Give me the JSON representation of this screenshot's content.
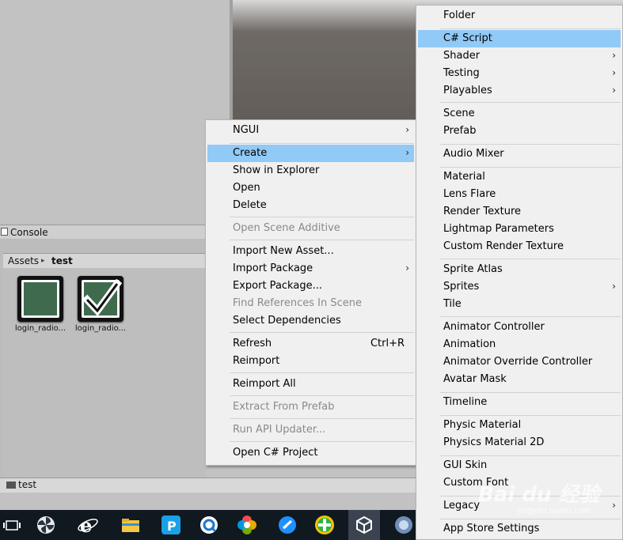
{
  "console": {
    "tab_label": "Console"
  },
  "breadcrumb": {
    "root": "Assets",
    "separator": "▸",
    "current": "test"
  },
  "assets": [
    {
      "name": "login_radio...",
      "icon": "empty-radio-icon"
    },
    {
      "name": "login_radio...",
      "icon": "checked-radio-icon"
    }
  ],
  "bottom_path": "test",
  "left_menu": {
    "items": [
      {
        "label": "NGUI",
        "submenu": true
      },
      {
        "label": "Create",
        "submenu": true,
        "highlighted": true
      },
      {
        "label": "Show in Explorer"
      },
      {
        "label": "Open"
      },
      {
        "label": "Delete"
      },
      {
        "label": "Open Scene Additive",
        "disabled": true
      },
      {
        "label": "Import New Asset..."
      },
      {
        "label": "Import Package",
        "submenu": true
      },
      {
        "label": "Export Package..."
      },
      {
        "label": "Find References In Scene",
        "disabled": true
      },
      {
        "label": "Select Dependencies"
      },
      {
        "label": "Refresh",
        "shortcut": "Ctrl+R"
      },
      {
        "label": "Reimport"
      },
      {
        "label": "Reimport All"
      },
      {
        "label": "Extract From Prefab",
        "disabled": true
      },
      {
        "label": "Run API Updater...",
        "disabled": true
      },
      {
        "label": "Open C# Project"
      }
    ]
  },
  "right_menu": {
    "items": [
      {
        "label": "Folder"
      },
      {
        "label": "C# Script",
        "highlighted": true
      },
      {
        "label": "Shader",
        "submenu": true
      },
      {
        "label": "Testing",
        "submenu": true
      },
      {
        "label": "Playables",
        "submenu": true
      },
      {
        "label": "Scene"
      },
      {
        "label": "Prefab"
      },
      {
        "label": "Audio Mixer"
      },
      {
        "label": "Material"
      },
      {
        "label": "Lens Flare"
      },
      {
        "label": "Render Texture"
      },
      {
        "label": "Lightmap Parameters"
      },
      {
        "label": "Custom Render Texture"
      },
      {
        "label": "Sprite Atlas"
      },
      {
        "label": "Sprites",
        "submenu": true
      },
      {
        "label": "Tile"
      },
      {
        "label": "Animator Controller"
      },
      {
        "label": "Animation"
      },
      {
        "label": "Animator Override Controller"
      },
      {
        "label": "Avatar Mask"
      },
      {
        "label": "Timeline"
      },
      {
        "label": "Physic Material"
      },
      {
        "label": "Physics Material 2D"
      },
      {
        "label": "GUI Skin"
      },
      {
        "label": "Custom Font"
      },
      {
        "label": "Legacy",
        "submenu": true
      },
      {
        "label": "App Store Settings"
      }
    ]
  },
  "arrow_glyph": "›",
  "taskbar": {
    "icons": [
      "task-view-icon",
      "fan-app-icon",
      "internet-explorer-icon",
      "file-explorer-icon",
      "p-app-icon",
      "q-app-icon",
      "photos-icon",
      "blue-circle-icon",
      "green-plus-icon",
      "unity-icon",
      "browser-icon"
    ]
  },
  "watermark": {
    "text": "Bai du 经验",
    "sub": "jingyan.baidu.com"
  }
}
